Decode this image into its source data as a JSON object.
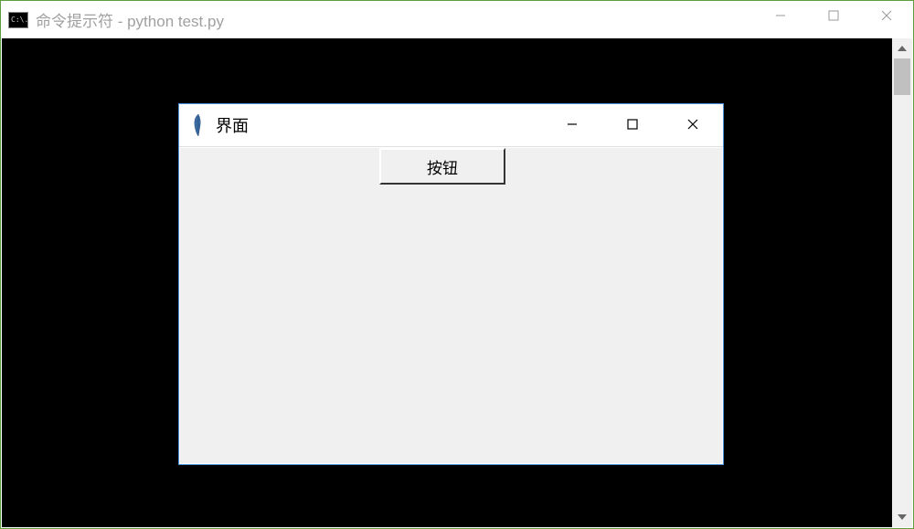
{
  "outer_window": {
    "title": "命令提示符 - python   test.py",
    "icon_text": "C:\\."
  },
  "inner_window": {
    "title": "界面",
    "button_label": "按钮"
  }
}
